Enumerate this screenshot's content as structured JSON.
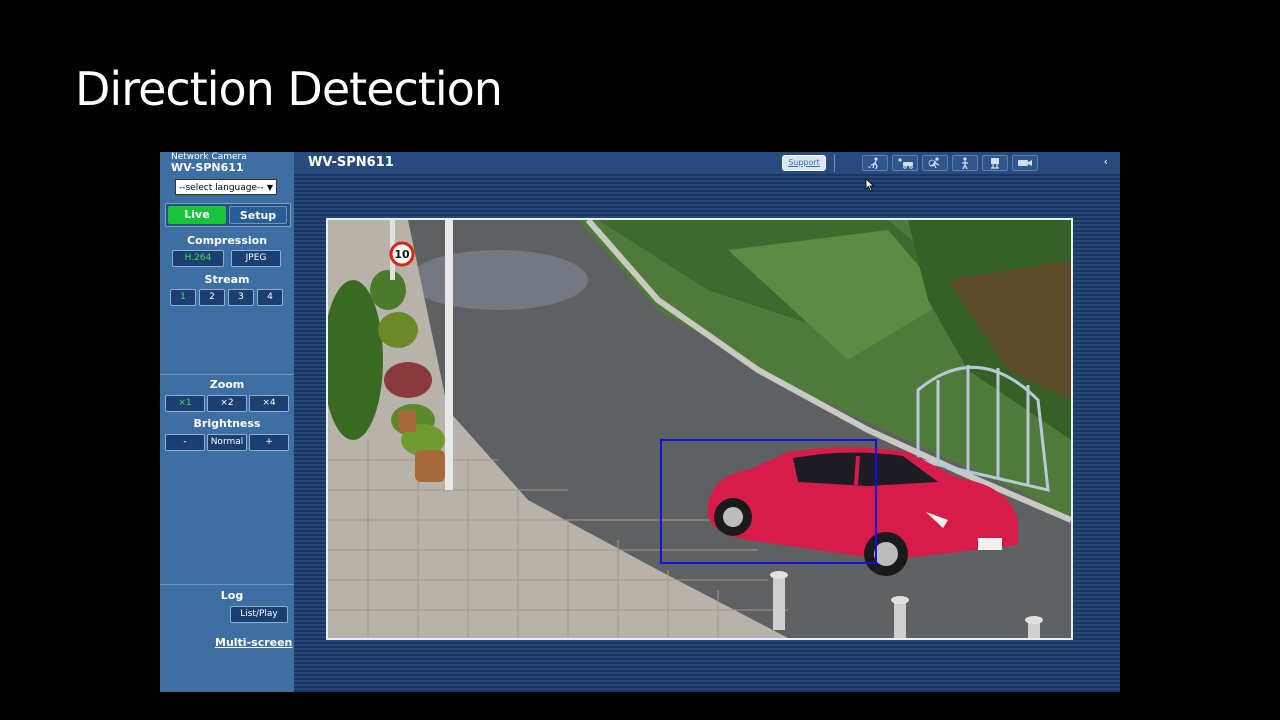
{
  "slide": {
    "title": "Direction Detection"
  },
  "camera": {
    "label": "Network Camera",
    "model": "WV-SPN611",
    "language_select": "--select language--",
    "tabs": {
      "live": "Live",
      "setup": "Setup"
    },
    "compression": {
      "label": "Compression",
      "options": [
        "H.264",
        "JPEG"
      ],
      "selected": "H.264"
    },
    "stream": {
      "label": "Stream",
      "options": [
        "1",
        "2",
        "3",
        "4"
      ],
      "selected": "1"
    },
    "zoom": {
      "label": "Zoom",
      "options": [
        "×1",
        "×2",
        "×4"
      ],
      "selected": "×1"
    },
    "brightness": {
      "label": "Brightness",
      "minus": "-",
      "normal": "Normal",
      "plus": "+"
    },
    "log": {
      "label": "Log",
      "button": "List/Play"
    },
    "multi_screen": "Multi-screen",
    "support": "Support",
    "header_icons": [
      "person-walk-icon",
      "vehicle-icon",
      "person-run-icon",
      "person-stand-icon",
      "flag-icon",
      "camera-tamper-icon"
    ]
  },
  "video": {
    "speed_sign": "10",
    "detection_box_color": "#1010e0",
    "car_color": "#d81c4a"
  },
  "colors": {
    "live_tab": "#19c43a",
    "selected_text": "#3ee04f",
    "sidebar": "#3d6fa3"
  }
}
